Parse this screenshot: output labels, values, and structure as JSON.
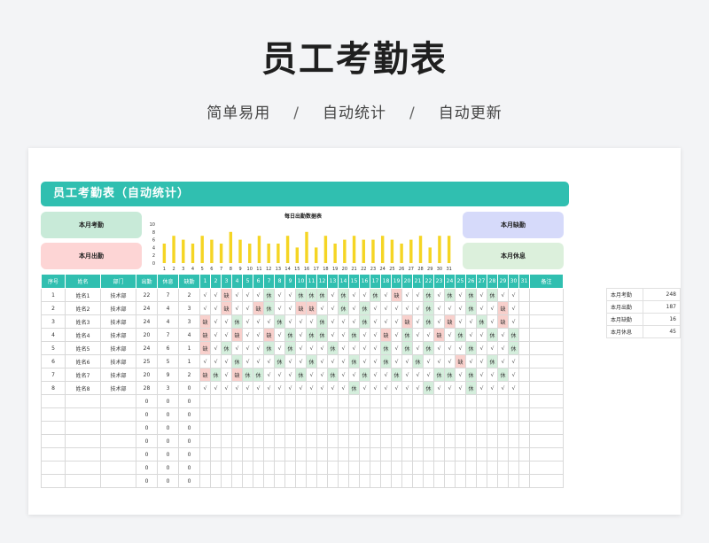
{
  "header": {
    "title": "员工考勤表",
    "sub": [
      "简单易用",
      "自动统计",
      "自动更新"
    ],
    "sep": "/"
  },
  "banner": "员工考勤表（自动统计）",
  "stat_boxes": {
    "attend": {
      "label": "本月考勤",
      "color": "#c8ead8"
    },
    "present": {
      "label": "本月出勤",
      "color": "#fdd5d5"
    },
    "absent": {
      "label": "本月缺勤",
      "color": "#d6dafa"
    },
    "rest": {
      "label": "本月休息",
      "color": "#dcf0dc"
    }
  },
  "chart_data": {
    "type": "bar",
    "title": "每日出勤数据表",
    "categories": [
      "1",
      "2",
      "3",
      "4",
      "5",
      "6",
      "7",
      "8",
      "9",
      "10",
      "11",
      "12",
      "13",
      "14",
      "15",
      "16",
      "17",
      "18",
      "19",
      "20",
      "21",
      "22",
      "23",
      "24",
      "25",
      "26",
      "27",
      "28",
      "29",
      "30",
      "31"
    ],
    "values": [
      5,
      7,
      6,
      5,
      7,
      6,
      5,
      8,
      6,
      5,
      7,
      5,
      5,
      7,
      4,
      8,
      4,
      7,
      5,
      6,
      7,
      6,
      6,
      7,
      6,
      5,
      6,
      7,
      4,
      7,
      7
    ],
    "ylim": [
      0,
      10
    ],
    "yticks": [
      0,
      2,
      4,
      6,
      8,
      10
    ],
    "bar_color": "#f5d524"
  },
  "table": {
    "headers": {
      "seq": "序号",
      "name": "姓名",
      "dept": "部门",
      "att": "出勤",
      "rest": "休息",
      "abs": "缺勤",
      "note": "备注"
    },
    "days": [
      "1",
      "2",
      "3",
      "4",
      "5",
      "6",
      "7",
      "8",
      "9",
      "10",
      "11",
      "12",
      "13",
      "14",
      "15",
      "16",
      "17",
      "18",
      "19",
      "20",
      "21",
      "22",
      "23",
      "24",
      "25",
      "26",
      "27",
      "28",
      "29",
      "30",
      "31"
    ],
    "rows": [
      {
        "seq": "1",
        "name": "姓名1",
        "dept": "技术部",
        "att": "22",
        "rest": "7",
        "abs": "2",
        "days": [
          "√",
          "√",
          "缺",
          "√",
          "√",
          "√",
          "休",
          "√",
          "√",
          "休",
          "休",
          "休",
          "√",
          "休",
          "√",
          "√",
          "休",
          "√",
          "缺",
          "√",
          "√",
          "休",
          "√",
          "休",
          "√",
          "休",
          "√",
          "休",
          "√",
          "√",
          ""
        ]
      },
      {
        "seq": "2",
        "name": "姓名2",
        "dept": "技术部",
        "att": "24",
        "rest": "4",
        "abs": "3",
        "days": [
          "√",
          "√",
          "缺",
          "√",
          "√",
          "缺",
          "休",
          "√",
          "√",
          "缺",
          "缺",
          "√",
          "√",
          "休",
          "√",
          "休",
          "√",
          "√",
          "√",
          "√",
          "√",
          "休",
          "√",
          "√",
          "√",
          "休",
          "√",
          "√",
          "缺",
          "√",
          ""
        ]
      },
      {
        "seq": "3",
        "name": "姓名3",
        "dept": "技术部",
        "att": "24",
        "rest": "4",
        "abs": "3",
        "days": [
          "缺",
          "√",
          "√",
          "休",
          "√",
          "√",
          "√",
          "休",
          "√",
          "√",
          "√",
          "休",
          "√",
          "√",
          "√",
          "休",
          "√",
          "√",
          "√",
          "缺",
          "√",
          "休",
          "√",
          "缺",
          "√",
          "√",
          "休",
          "√",
          "缺",
          "√",
          ""
        ]
      },
      {
        "seq": "4",
        "name": "姓名4",
        "dept": "技术部",
        "att": "20",
        "rest": "7",
        "abs": "4",
        "days": [
          "缺",
          "√",
          "√",
          "缺",
          "√",
          "√",
          "缺",
          "√",
          "休",
          "√",
          "休",
          "休",
          "√",
          "√",
          "休",
          "√",
          "√",
          "缺",
          "√",
          "休",
          "√",
          "√",
          "缺",
          "√",
          "休",
          "√",
          "√",
          "休",
          "√",
          "休",
          ""
        ]
      },
      {
        "seq": "5",
        "name": "姓名5",
        "dept": "技术部",
        "att": "24",
        "rest": "6",
        "abs": "1",
        "days": [
          "缺",
          "√",
          "休",
          "√",
          "√",
          "√",
          "休",
          "√",
          "休",
          "√",
          "√",
          "√",
          "休",
          "√",
          "√",
          "√",
          "√",
          "休",
          "√",
          "休",
          "√",
          "休",
          "√",
          "√",
          "√",
          "休",
          "√",
          "√",
          "√",
          "休",
          ""
        ]
      },
      {
        "seq": "6",
        "name": "姓名6",
        "dept": "技术部",
        "att": "25",
        "rest": "5",
        "abs": "1",
        "days": [
          "√",
          "√",
          "√",
          "休",
          "√",
          "√",
          "√",
          "休",
          "√",
          "√",
          "休",
          "√",
          "√",
          "√",
          "休",
          "√",
          "√",
          "休",
          "√",
          "√",
          "休",
          "√",
          "√",
          "√",
          "缺",
          "√",
          "√",
          "休",
          "√",
          "√",
          ""
        ]
      },
      {
        "seq": "7",
        "name": "姓名7",
        "dept": "技术部",
        "att": "20",
        "rest": "9",
        "abs": "2",
        "days": [
          "缺",
          "休",
          "√",
          "缺",
          "休",
          "休",
          "√",
          "√",
          "√",
          "休",
          "√",
          "√",
          "休",
          "√",
          "√",
          "休",
          "√",
          "√",
          "休",
          "√",
          "√",
          "√",
          "休",
          "休",
          "√",
          "休",
          "√",
          "√",
          "休",
          "√",
          ""
        ]
      },
      {
        "seq": "8",
        "name": "姓名8",
        "dept": "技术部",
        "att": "28",
        "rest": "3",
        "abs": "0",
        "days": [
          "√",
          "√",
          "√",
          "√",
          "√",
          "√",
          "√",
          "√",
          "√",
          "√",
          "√",
          "√",
          "√",
          "√",
          "休",
          "√",
          "√",
          "√",
          "√",
          "√",
          "√",
          "休",
          "√",
          "√",
          "√",
          "休",
          "√",
          "√",
          "√",
          "√",
          ""
        ]
      },
      {
        "seq": "",
        "name": "",
        "dept": "",
        "att": "0",
        "rest": "0",
        "abs": "0",
        "days": []
      },
      {
        "seq": "",
        "name": "",
        "dept": "",
        "att": "0",
        "rest": "0",
        "abs": "0",
        "days": []
      },
      {
        "seq": "",
        "name": "",
        "dept": "",
        "att": "0",
        "rest": "0",
        "abs": "0",
        "days": []
      },
      {
        "seq": "",
        "name": "",
        "dept": "",
        "att": "0",
        "rest": "0",
        "abs": "0",
        "days": []
      },
      {
        "seq": "",
        "name": "",
        "dept": "",
        "att": "0",
        "rest": "0",
        "abs": "0",
        "days": []
      },
      {
        "seq": "",
        "name": "",
        "dept": "",
        "att": "0",
        "rest": "0",
        "abs": "0",
        "days": []
      },
      {
        "seq": "",
        "name": "",
        "dept": "",
        "att": "0",
        "rest": "0",
        "abs": "0",
        "days": []
      }
    ]
  },
  "summary": [
    {
      "label": "本月考勤",
      "value": "248"
    },
    {
      "label": "本月出勤",
      "value": "187"
    },
    {
      "label": "本月缺勤",
      "value": "16"
    },
    {
      "label": "本月休息",
      "value": "45"
    }
  ],
  "colors": {
    "accent": "#30bfb0",
    "rest_cell": "#d4eedc",
    "absent_cell": "#f8d0cc"
  }
}
